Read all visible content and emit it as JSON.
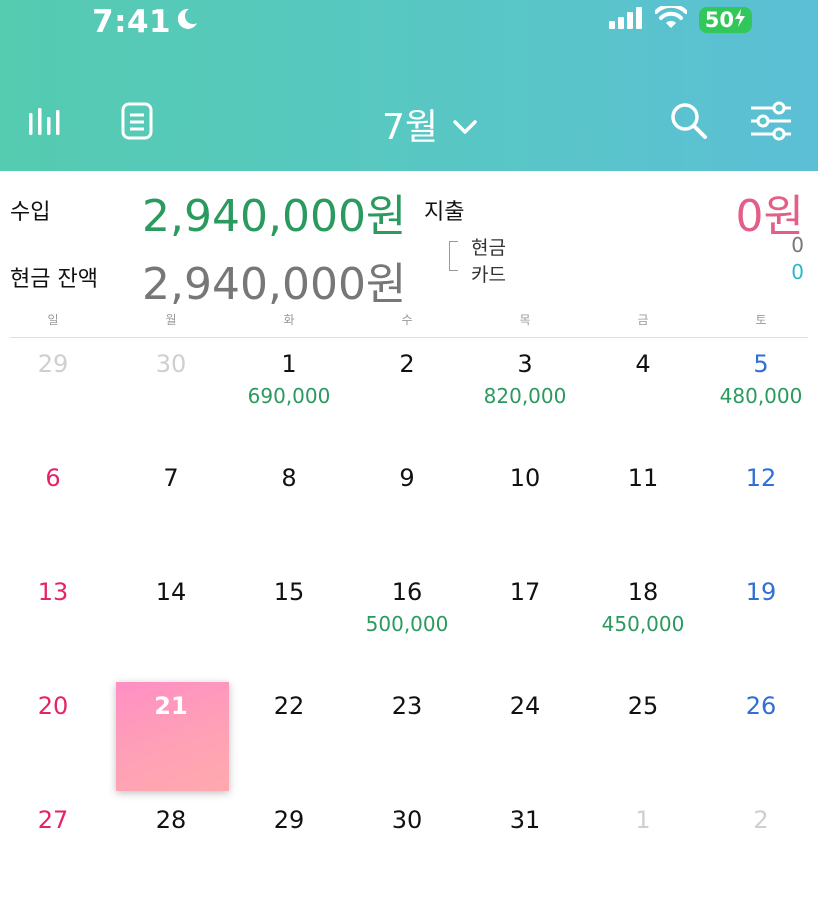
{
  "status_bar": {
    "time": "7:41",
    "battery": "50"
  },
  "nav": {
    "month_label": "7월"
  },
  "summary": {
    "income_label": "수입",
    "income_value": "2,940,000원",
    "expense_label": "지출",
    "expense_value": "0원",
    "cash_balance_label": "현금 잔액",
    "cash_balance_value": "2,940,000원",
    "cash_label": "현금",
    "cash_value": "0",
    "card_label": "카드",
    "card_value": "0"
  },
  "weekdays": [
    "일",
    "월",
    "화",
    "수",
    "목",
    "금",
    "토"
  ],
  "calendar": {
    "weeks": [
      [
        {
          "day": "29",
          "muted": true,
          "amount": ""
        },
        {
          "day": "30",
          "muted": true,
          "amount": ""
        },
        {
          "day": "1",
          "amount": "690,000"
        },
        {
          "day": "2",
          "amount": ""
        },
        {
          "day": "3",
          "amount": "820,000"
        },
        {
          "day": "4",
          "amount": ""
        },
        {
          "day": "5",
          "amount": "480,000"
        }
      ],
      [
        {
          "day": "6",
          "amount": ""
        },
        {
          "day": "7",
          "amount": ""
        },
        {
          "day": "8",
          "amount": ""
        },
        {
          "day": "9",
          "amount": ""
        },
        {
          "day": "10",
          "amount": ""
        },
        {
          "day": "11",
          "amount": ""
        },
        {
          "day": "12",
          "amount": ""
        }
      ],
      [
        {
          "day": "13",
          "amount": ""
        },
        {
          "day": "14",
          "amount": ""
        },
        {
          "day": "15",
          "amount": ""
        },
        {
          "day": "16",
          "amount": "500,000"
        },
        {
          "day": "17",
          "amount": ""
        },
        {
          "day": "18",
          "amount": "450,000"
        },
        {
          "day": "19",
          "amount": ""
        }
      ],
      [
        {
          "day": "20",
          "amount": ""
        },
        {
          "day": "21",
          "today": true,
          "amount": ""
        },
        {
          "day": "22",
          "amount": ""
        },
        {
          "day": "23",
          "amount": ""
        },
        {
          "day": "24",
          "amount": ""
        },
        {
          "day": "25",
          "amount": ""
        },
        {
          "day": "26",
          "amount": ""
        }
      ],
      [
        {
          "day": "27",
          "amount": ""
        },
        {
          "day": "28",
          "amount": ""
        },
        {
          "day": "29",
          "amount": ""
        },
        {
          "day": "30",
          "amount": ""
        },
        {
          "day": "31",
          "amount": ""
        },
        {
          "day": "1",
          "muted": true,
          "amount": ""
        },
        {
          "day": "2",
          "muted": true,
          "amount": ""
        }
      ]
    ]
  },
  "colors": {
    "header_start": "#55cbb0",
    "header_end": "#5cbfd6",
    "income": "#2a9a5e",
    "expense": "#e35f87",
    "sunday": "#e5226a",
    "saturday": "#2f6fd6",
    "muted": "#cfcfcf",
    "card": "#2bb7c9"
  }
}
